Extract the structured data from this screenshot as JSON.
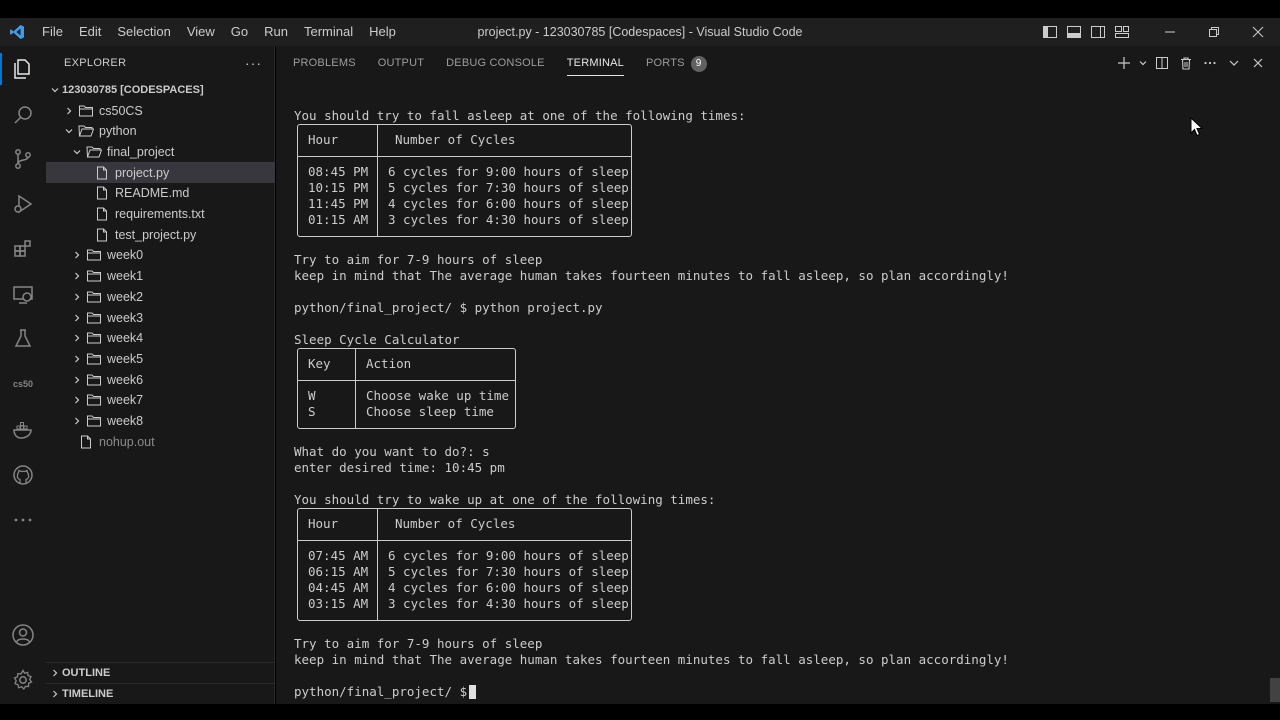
{
  "titlebar": {
    "menu": [
      "File",
      "Edit",
      "Selection",
      "View",
      "Go",
      "Run",
      "Terminal",
      "Help"
    ],
    "title": "project.py - 123030785 [Codespaces] - Visual Studio Code"
  },
  "activity": {
    "icons": [
      "explorer-icon",
      "search-icon",
      "source-control-icon",
      "run-debug-icon",
      "extensions-icon",
      "remote-explorer-icon",
      "testing-icon",
      "cs50-icon",
      "docker-icon",
      "github-icon",
      "more-icon",
      "accounts-icon",
      "manage-gear-icon"
    ],
    "cs50_label": "cs50"
  },
  "explorer": {
    "header": "EXPLORER",
    "root": "123030785 [CODESPACES]",
    "items": [
      {
        "label": "cs50CS",
        "type": "folder",
        "depth": 1,
        "expanded": false
      },
      {
        "label": "python",
        "type": "folder",
        "depth": 1,
        "expanded": true
      },
      {
        "label": "final_project",
        "type": "folder",
        "depth": 2,
        "expanded": true
      },
      {
        "label": "project.py",
        "type": "file",
        "depth": 3,
        "selected": true
      },
      {
        "label": "README.md",
        "type": "file",
        "depth": 3
      },
      {
        "label": "requirements.txt",
        "type": "file",
        "depth": 3
      },
      {
        "label": "test_project.py",
        "type": "file",
        "depth": 3
      },
      {
        "label": "week0",
        "type": "folder",
        "depth": 2,
        "expanded": false
      },
      {
        "label": "week1",
        "type": "folder",
        "depth": 2,
        "expanded": false
      },
      {
        "label": "week2",
        "type": "folder",
        "depth": 2,
        "expanded": false
      },
      {
        "label": "week3",
        "type": "folder",
        "depth": 2,
        "expanded": false
      },
      {
        "label": "week4",
        "type": "folder",
        "depth": 2,
        "expanded": false
      },
      {
        "label": "week5",
        "type": "folder",
        "depth": 2,
        "expanded": false
      },
      {
        "label": "week6",
        "type": "folder",
        "depth": 2,
        "expanded": false
      },
      {
        "label": "week7",
        "type": "folder",
        "depth": 2,
        "expanded": false
      },
      {
        "label": "week8",
        "type": "folder",
        "depth": 2,
        "expanded": false
      },
      {
        "label": "nohup.out",
        "type": "file",
        "depth": 1,
        "dim": true
      }
    ],
    "outline": "OUTLINE",
    "timeline": "TIMELINE"
  },
  "panel": {
    "tabs": [
      "PROBLEMS",
      "OUTPUT",
      "DEBUG CONSOLE",
      "TERMINAL",
      "PORTS"
    ],
    "active_tab": "TERMINAL",
    "ports_count": "9"
  },
  "terminal": {
    "line_fall_asleep": "You should try to fall asleep at one of the following times:",
    "table1": {
      "headers": [
        "Hour",
        "Number of Cycles"
      ],
      "rows": [
        [
          "08:45 PM",
          "6 cycles for 9:00 hours of sleep"
        ],
        [
          "10:15 PM",
          "5 cycles for 7:30 hours of sleep"
        ],
        [
          "11:45 PM",
          "4 cycles for 6:00 hours of sleep"
        ],
        [
          "01:15 AM",
          "3 cycles for 4:30 hours of sleep"
        ]
      ]
    },
    "aim_line": "Try to aim for 7-9 hours of sleep",
    "keep_line": "keep in mind that The average human takes fourteen minutes to fall asleep, so plan accordingly!",
    "prompt_command": "python/final_project/ $ python project.py",
    "calc_title": "Sleep Cycle Calculator",
    "menu_table": {
      "headers": [
        "Key",
        "Action"
      ],
      "rows": [
        [
          "W",
          "Choose wake up time"
        ],
        [
          "S",
          "Choose sleep time"
        ]
      ]
    },
    "question": "What do you want to do?: s",
    "enter_time": "enter desired time: 10:45 pm",
    "line_wake_up": "You should try to wake up at one of the following times:",
    "table2": {
      "headers": [
        "Hour",
        "Number of Cycles"
      ],
      "rows": [
        [
          "07:45 AM",
          "6 cycles for 9:00 hours of sleep"
        ],
        [
          "06:15 AM",
          "5 cycles for 7:30 hours of sleep"
        ],
        [
          "04:45 AM",
          "4 cycles for 6:00 hours of sleep"
        ],
        [
          "03:15 AM",
          "3 cycles for 4:30 hours of sleep"
        ]
      ]
    },
    "aim_line2": "Try to aim for 7-9 hours of sleep",
    "keep_line2": "keep in mind that The average human takes fourteen minutes to fall asleep, so plan accordingly!",
    "prompt_final": "python/final_project/ $ "
  },
  "colors": {
    "accent": "#0078d4",
    "vscode_blue": "#3e9cf0",
    "background": "#181818"
  }
}
